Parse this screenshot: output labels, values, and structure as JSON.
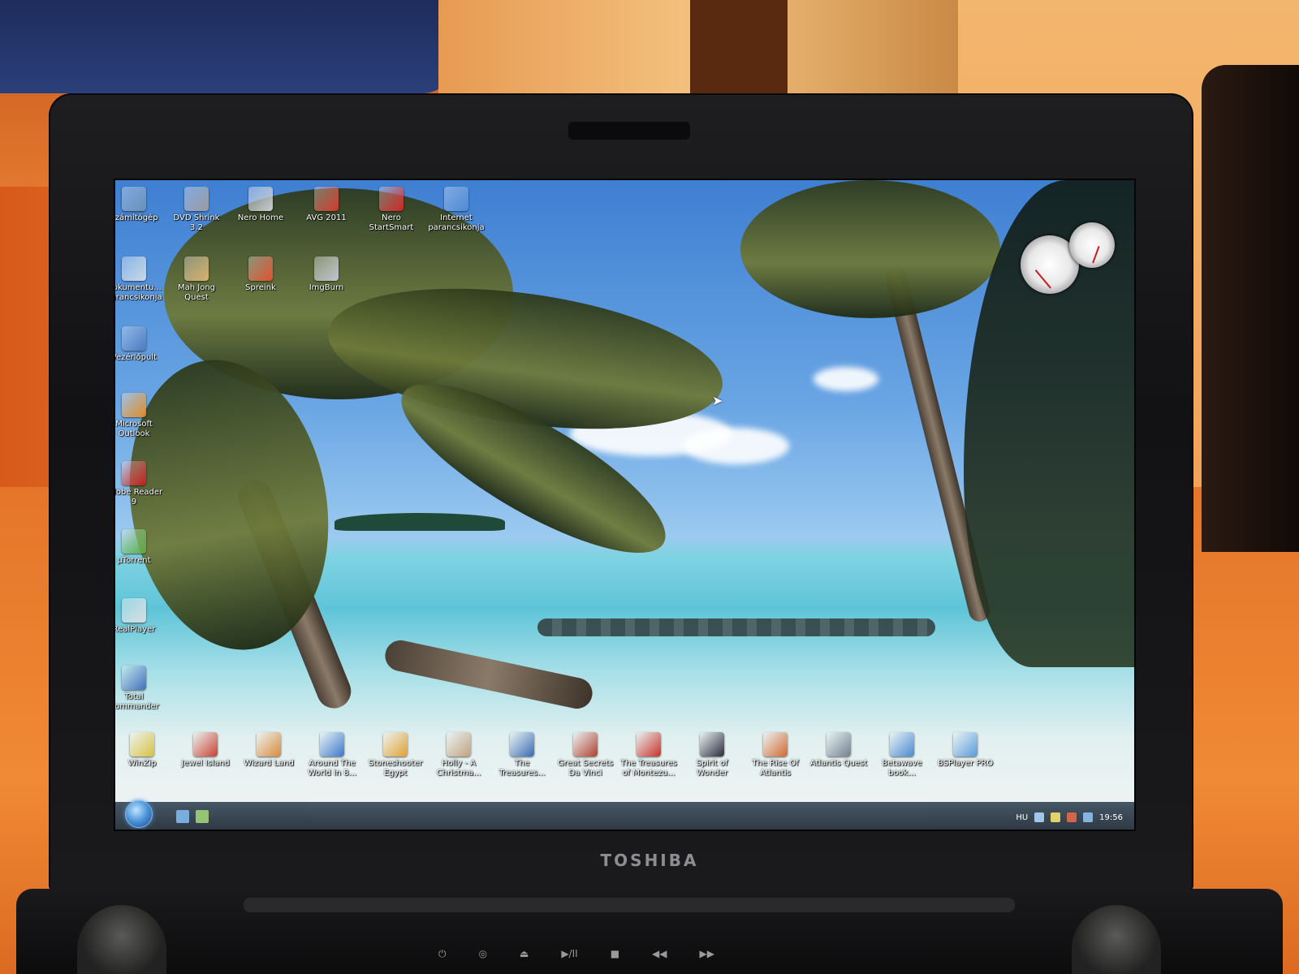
{
  "laptop": {
    "brand": "TOSHIBA",
    "media_buttons": [
      "⏻",
      "◎",
      "⏏",
      "▶/II",
      "■",
      "◀◀",
      "▶▶"
    ]
  },
  "desktop": {
    "icons": [
      {
        "label": "Számítógép",
        "color": "#6a8fb8"
      },
      {
        "label": "DVD Shrink\n3.2",
        "color": "#9a9aa0"
      },
      {
        "label": "Nero Home",
        "color": "#c8ccd4"
      },
      {
        "label": "AVG 2011",
        "color": "#d23a2a"
      },
      {
        "label": "Nero\nStartSmart",
        "color": "#d02626"
      },
      {
        "label": "Internet\nparancsikonja",
        "color": "#4f8ad6"
      },
      {
        "label": "Dokumentu...\nparancsikonja",
        "color": "#c8d8e8"
      },
      {
        "label": "Mah Jong\nQuest",
        "color": "#d8b070"
      },
      {
        "label": "Spreink",
        "color": "#e05030"
      },
      {
        "label": "ImgBurn",
        "color": "#c0c4cc"
      },
      {
        "label": "Vezérlőpult",
        "color": "#4a7ac0"
      },
      {
        "label": "Microsoft\nOutlook",
        "color": "#e08a24"
      },
      {
        "label": "Adobe Reader\n9",
        "color": "#c41e1e"
      },
      {
        "label": "µTorrent",
        "color": "#58a845"
      },
      {
        "label": "RealPlayer",
        "color": "#d8dde2"
      },
      {
        "label": "Total\nCommander",
        "color": "#3f6fb8"
      },
      {
        "label": "WinZip",
        "color": "#d8c040"
      },
      {
        "label": "Jewel Island",
        "color": "#c84030"
      },
      {
        "label": "Wizard Land",
        "color": "#d88a3a"
      },
      {
        "label": "Around The\nWorld in 8...",
        "color": "#3a78c8"
      },
      {
        "label": "Stoneshooter\nEgypt",
        "color": "#e0a030"
      },
      {
        "label": "Holly - A\nChristma...",
        "color": "#c0a080"
      },
      {
        "label": "The\nTreasures...",
        "color": "#3a6ab0"
      },
      {
        "label": "Great Secrets\nDa Vinci",
        "color": "#b04030"
      },
      {
        "label": "The Treasures\nof Montezu...",
        "color": "#c83028"
      },
      {
        "label": "Spirit of\nWonder",
        "color": "#2a2a3a"
      },
      {
        "label": "The Rise Of\nAtlantis",
        "color": "#d06a30"
      },
      {
        "label": "Atlantis Quest",
        "color": "#708090"
      },
      {
        "label": "Betawave\nbook...",
        "color": "#4a88d0"
      },
      {
        "label": "BSPlayer PRO",
        "color": "#5a9ad8"
      }
    ]
  },
  "taskbar": {
    "clock": "19:56",
    "lang": "HU",
    "start_color": "#3a8bd6",
    "quick_launch_colors": [
      "#6fa8dc",
      "#8fc06a"
    ],
    "tray_colors": [
      "#9cc3e6",
      "#e0d060",
      "#d05a3a",
      "#7bb0e0"
    ]
  }
}
